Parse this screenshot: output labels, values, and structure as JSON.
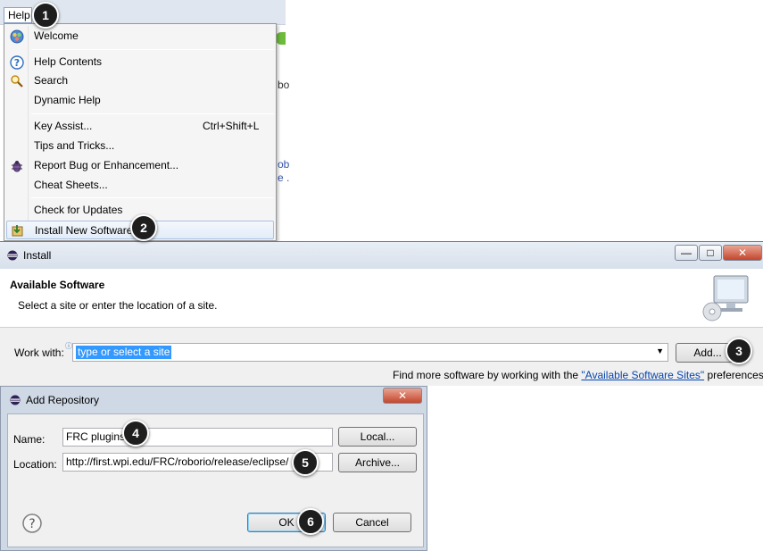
{
  "help_menu": {
    "title": "Help",
    "items": {
      "welcome": "Welcome",
      "help_contents": "Help Contents",
      "search": "Search",
      "dynamic_help": "Dynamic Help",
      "key_assist": "Key Assist...",
      "key_assist_shortcut": "Ctrl+Shift+L",
      "tips": "Tips and Tricks...",
      "report_bug": "Report Bug or Enhancement...",
      "cheat_sheets": "Cheat Sheets...",
      "check_updates": "Check for Updates",
      "install_software": "Install New Software..."
    }
  },
  "background_text": {
    "frag1": "bo",
    "frag2": "ob",
    "frag3": "e ."
  },
  "install_window": {
    "title": "Install",
    "header_title": "Available Software",
    "header_subtitle": "Select a site or enter the location of a site.",
    "work_with_label": "Work with:",
    "work_with_value": "type or select a site",
    "add_button": "Add...",
    "find_more_prefix": "Find more software by working with the ",
    "find_more_link": "\"Available Software Sites\"",
    "find_more_suffix": " preferences."
  },
  "add_repository": {
    "title": "Add Repository",
    "name_label": "Name:",
    "name_value": "FRC plugins",
    "location_label": "Location:",
    "location_value": "http://first.wpi.edu/FRC/roborio/release/eclipse/",
    "local_button": "Local...",
    "archive_button": "Archive...",
    "ok_button": "OK",
    "cancel_button": "Cancel"
  },
  "callouts": [
    "1",
    "2",
    "3",
    "4",
    "5",
    "6"
  ],
  "colors": {
    "accent_selection": "#3399ff",
    "link": "#0645ad",
    "callout": "#1e1e1e",
    "close_button": "#c4462d"
  }
}
